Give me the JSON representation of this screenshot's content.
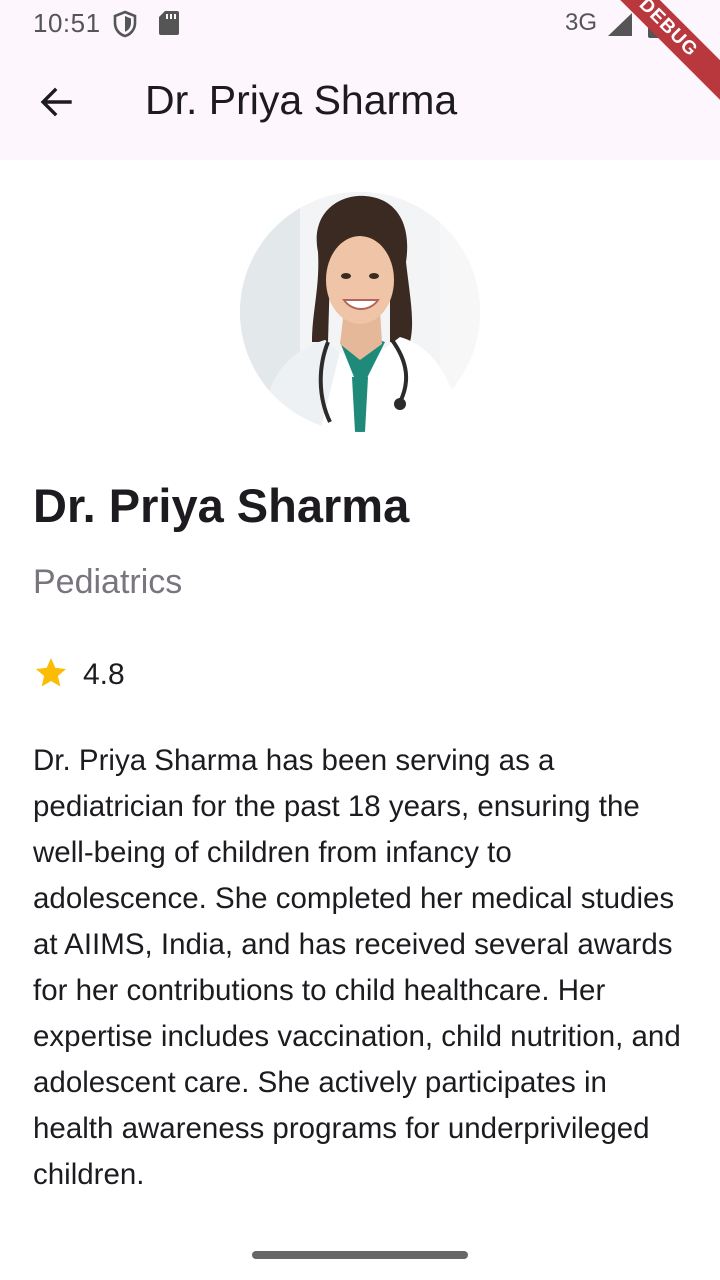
{
  "status_bar": {
    "time": "10:51",
    "network": "3G",
    "icons": [
      "shield-icon",
      "sd-card-icon",
      "signal-icon",
      "battery-icon"
    ]
  },
  "app_bar": {
    "title": "Dr. Priya Sharma",
    "back_icon": "arrow-back-icon"
  },
  "debug_banner": "DEBUG",
  "doctor": {
    "name": "Dr. Priya Sharma",
    "specialty": "Pediatrics",
    "rating": "4.8",
    "rating_icon": "star-icon",
    "bio": "Dr. Priya Sharma has been serving as a pediatrician for the past 18 years, ensuring the well-being of children from infancy to adolescence. She completed her medical studies at AIIMS, India, and has received several awards for her contributions to child healthcare. Her expertise includes vaccination, child nutrition, and adolescent care. She actively participates in health awareness programs for underprivileged children."
  },
  "colors": {
    "app_bar_bg": "#fdf7fd",
    "star": "#fbbc04",
    "debug_banner": "#b8383e",
    "secondary_text": "#79747e"
  }
}
